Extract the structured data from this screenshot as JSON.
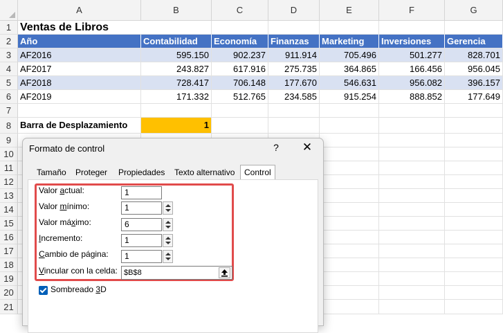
{
  "columns": [
    "A",
    "B",
    "C",
    "D",
    "E",
    "F",
    "G"
  ],
  "rows": [
    "1",
    "2",
    "3",
    "4",
    "5",
    "6",
    "7",
    "8",
    "9",
    "10",
    "11",
    "12",
    "13",
    "14",
    "15",
    "16",
    "17",
    "18",
    "19",
    "20",
    "21"
  ],
  "sheet": {
    "title": "Ventas de Libros",
    "headers": [
      "Año",
      "Contabilidad",
      "Economía",
      "Finanzas",
      "Marketing",
      "Inversiones",
      "Gerencia"
    ],
    "data": [
      [
        "AF2016",
        "595.150",
        "902.237",
        "911.914",
        "705.496",
        "501.277",
        "828.701"
      ],
      [
        "AF2017",
        "243.827",
        "617.916",
        "275.735",
        "364.865",
        "166.456",
        "956.045"
      ],
      [
        "AF2018",
        "728.417",
        "706.148",
        "177.670",
        "546.631",
        "956.082",
        "396.157"
      ],
      [
        "AF2019",
        "171.332",
        "512.765",
        "234.585",
        "915.254",
        "888.852",
        "177.649"
      ]
    ],
    "scroll_label": "Barra de Desplazamiento",
    "scroll_value": "1"
  },
  "dialog": {
    "title": "Formato de control",
    "help": "?",
    "close": "✕",
    "tabs": [
      "Tamaño",
      "Proteger",
      "Propiedades",
      "Texto alternativo",
      "Control"
    ],
    "fields": {
      "valor_actual": {
        "label_pre": "Valor ",
        "label_u": "a",
        "label_post": "ctual:",
        "value": "1"
      },
      "valor_minimo": {
        "label_pre": "Valor ",
        "label_u": "m",
        "label_post": "ínimo:",
        "value": "1"
      },
      "valor_maximo": {
        "label_pre": "Valor má",
        "label_u": "x",
        "label_post": "imo:",
        "value": "6"
      },
      "incremento": {
        "label_pre": "",
        "label_u": "I",
        "label_post": "ncremento:",
        "value": "1"
      },
      "cambio_pagina": {
        "label_pre": "",
        "label_u": "C",
        "label_post": "ambio de página:",
        "value": "1"
      },
      "vincular": {
        "label_pre": "",
        "label_u": "V",
        "label_post": "incular con la celda:",
        "value": "$B$8"
      }
    },
    "checkbox": {
      "label_pre": "Sombreado ",
      "label_u": "3",
      "label_post": "D",
      "checked": true
    }
  }
}
